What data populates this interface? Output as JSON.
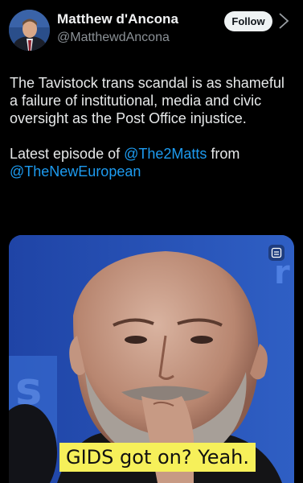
{
  "author": {
    "name": "Matthew d'Ancona",
    "handle": "@MatthewdAncona",
    "avatar_icon": "profile-photo"
  },
  "follow_label": "Follow",
  "tweet": {
    "line_1": "The Tavistock trans scandal is as shameful a failure of institutional, media and civic oversight as the Post Office injustice.",
    "line_2_prefix": "Latest episode of ",
    "mention_1": "@The2Matts",
    "line_2_mid": " from",
    "mention_2": "@TheNewEuropean"
  },
  "media": {
    "caption": "GIDS got on? Yeah.",
    "background_color": "#274cae",
    "caption_bg": "#f6f05a",
    "corner_icon": "gallery-icon"
  },
  "colors": {
    "link": "#1d9bf0",
    "text": "#e7e9ea",
    "secondary": "#8b9196"
  }
}
